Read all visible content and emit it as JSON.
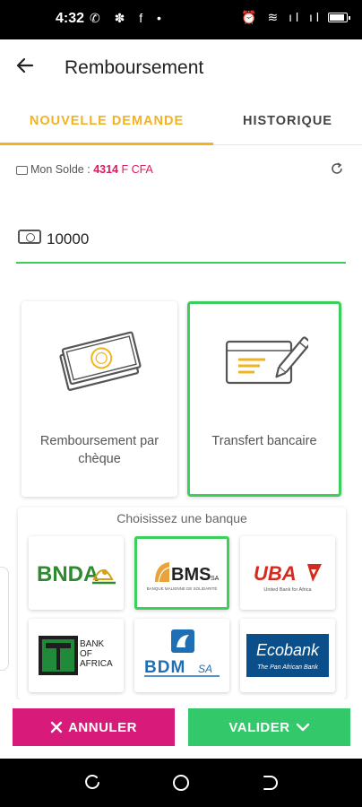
{
  "status_bar": {
    "time": "4:32",
    "left_icons": "✆ ✽ f •",
    "right_icons": "⏰ ≋ ıl ıl"
  },
  "header": {
    "back_icon": "arrow-left-icon",
    "title": "Remboursement"
  },
  "tabs": [
    {
      "label": "NOUVELLE DEMANDE",
      "active": true
    },
    {
      "label": "HISTORIQUE",
      "active": false
    }
  ],
  "balance": {
    "label": "Mon Solde : ",
    "amount": "4314",
    "currency": " F CFA"
  },
  "amount_input": {
    "value": "10000"
  },
  "methods": [
    {
      "label": "Remboursement par chèque",
      "icon": "banknote-icon",
      "selected": false
    },
    {
      "label": "Transfert bancaire",
      "icon": "cheque-pen-icon",
      "selected": true
    }
  ],
  "banks": {
    "title": "Choisissez une banque",
    "items": [
      {
        "name": "BNDA",
        "selected": false
      },
      {
        "name": "BMS",
        "suffix": "SA",
        "tagline": "BANQUE MALIENNE DE SOLIDARITÉ",
        "selected": true
      },
      {
        "name": "UBA",
        "tagline": "United Bank for Africa",
        "selected": false
      },
      {
        "name": "BANK OF AFRICA",
        "lines": [
          "BANK",
          "OF",
          "AFRICA"
        ],
        "selected": false
      },
      {
        "name": "BDM",
        "suffix": "SA",
        "selected": false
      },
      {
        "name": "Ecobank",
        "tagline": "The Pan African Bank",
        "selected": false
      }
    ]
  },
  "actions": {
    "cancel_label": "ANNULER",
    "validate_label": "VALIDER"
  },
  "colors": {
    "accent_tab": "#f2b320",
    "selected_border": "#3ccf5c",
    "cancel_bg": "#d81b7b",
    "validate_bg": "#33c86a",
    "balance": "#d81b60"
  }
}
